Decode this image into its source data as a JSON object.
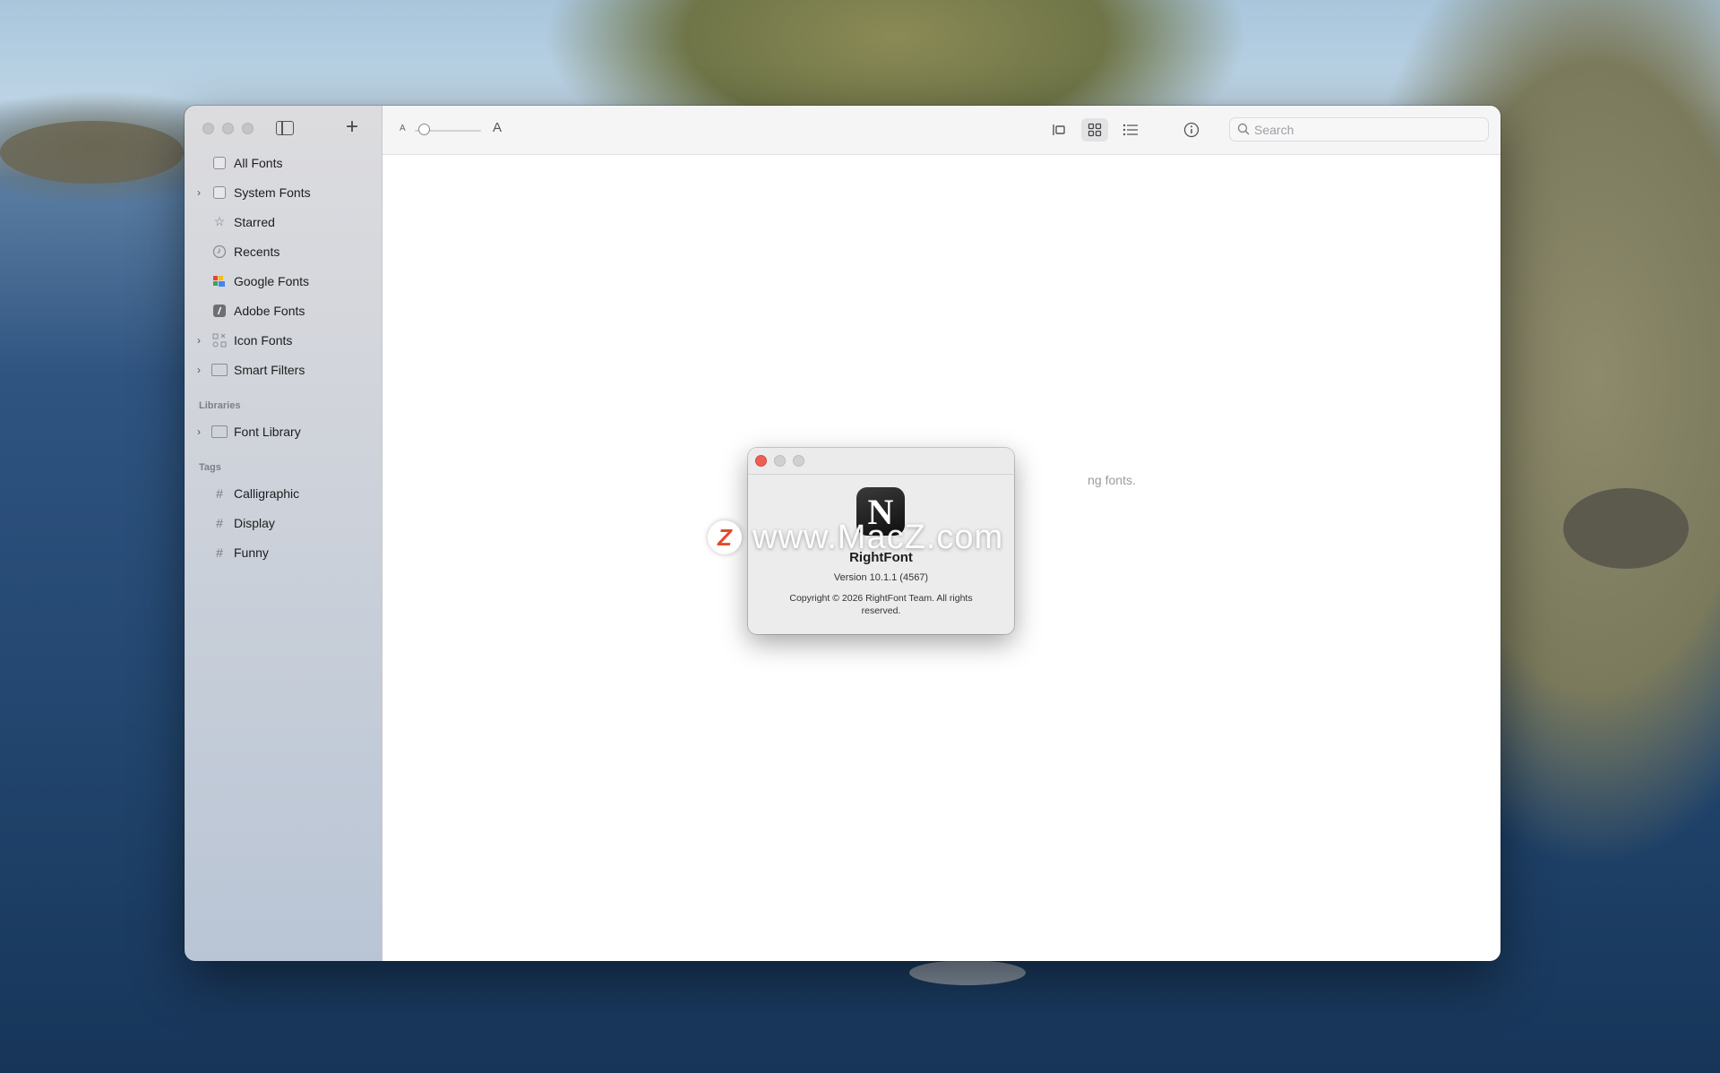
{
  "sidebar": {
    "items": [
      {
        "label": "All Fonts",
        "icon": "all-fonts-icon",
        "chevron": false
      },
      {
        "label": "System Fonts",
        "icon": "system-fonts-icon",
        "chevron": true
      },
      {
        "label": "Starred",
        "icon": "star-icon",
        "chevron": false
      },
      {
        "label": "Recents",
        "icon": "clock-icon",
        "chevron": false
      },
      {
        "label": "Google Fonts",
        "icon": "google-fonts-icon",
        "chevron": false
      },
      {
        "label": "Adobe Fonts",
        "icon": "adobe-fonts-icon",
        "chevron": false
      },
      {
        "label": "Icon Fonts",
        "icon": "icon-fonts-icon",
        "chevron": true
      },
      {
        "label": "Smart Filters",
        "icon": "folder-icon",
        "chevron": true
      }
    ],
    "libraries_label": "Libraries",
    "libraries": [
      {
        "label": "Font Library",
        "icon": "library-icon",
        "chevron": true
      }
    ],
    "tags_label": "Tags",
    "tags": [
      {
        "label": "Calligraphic"
      },
      {
        "label": "Display"
      },
      {
        "label": "Funny"
      }
    ]
  },
  "toolbar": {
    "size_small_label": "A",
    "size_large_label": "A",
    "search_placeholder": "Search"
  },
  "main": {
    "empty_text_visible": "ng fonts."
  },
  "about": {
    "app_name": "RightFont",
    "version": "Version 10.1.1 (4567)",
    "copyright": "Copyright © 2026 RightFont Team. All rights reserved.",
    "icon_letter": "N"
  },
  "watermark": {
    "logo_letter": "Z",
    "text": "www.MacZ.com"
  },
  "colors": {
    "close": "#ec5f57",
    "inactive": "#d0d0d2",
    "accent": "#e54a2a"
  }
}
